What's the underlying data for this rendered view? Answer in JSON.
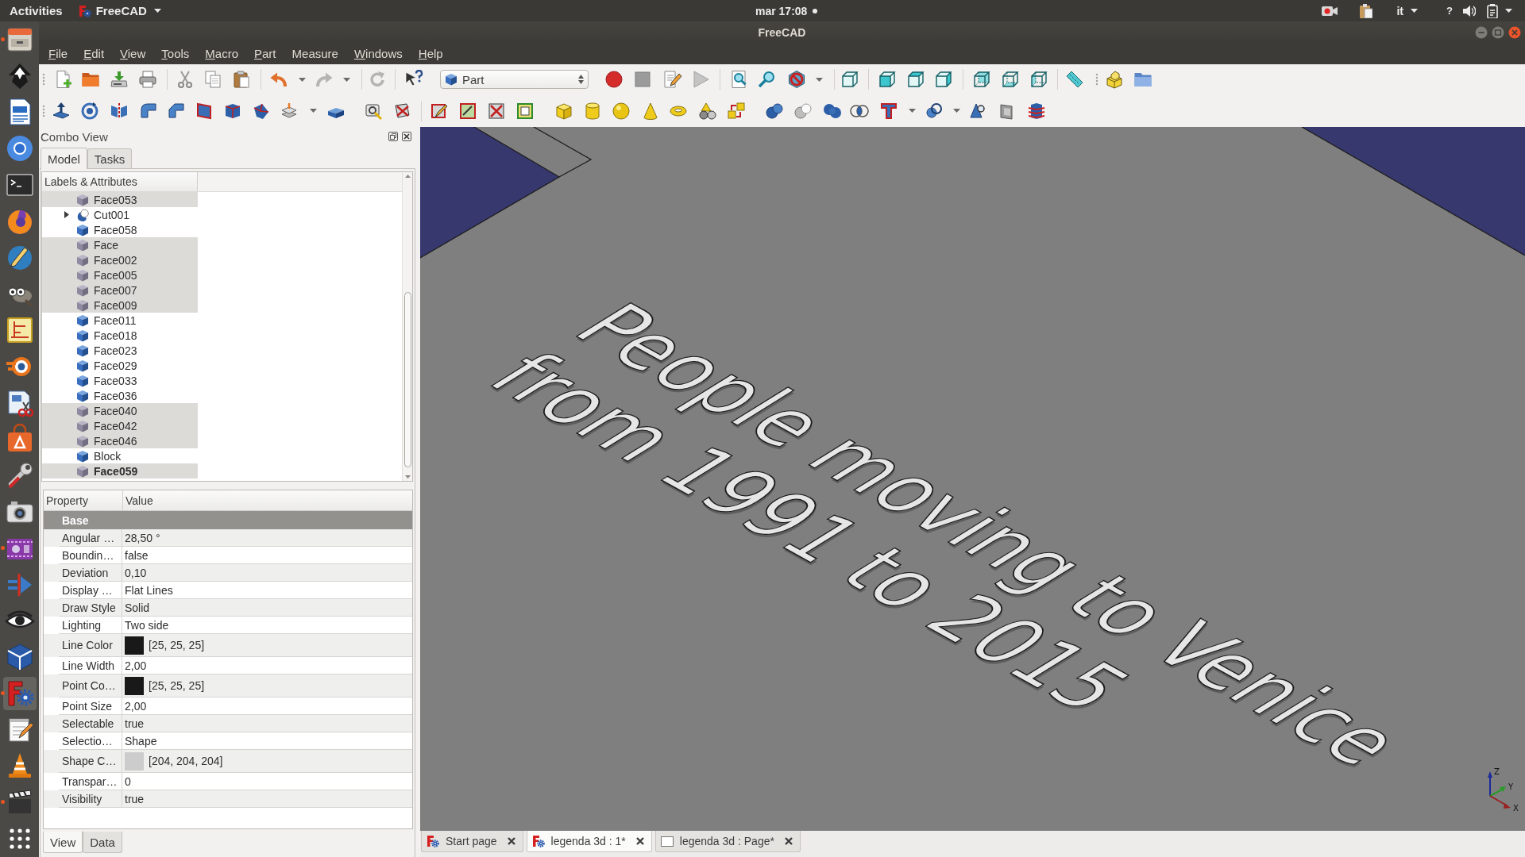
{
  "top_bar": {
    "activities": "Activities",
    "app_menu": "FreeCAD",
    "clock": "mar 17:08",
    "notification": true,
    "keyboard_layout": "it",
    "indicator": "?"
  },
  "launcher": [
    {
      "running": true,
      "selected": false
    },
    {
      "running": false,
      "selected": false
    },
    {
      "running": false,
      "selected": false
    },
    {
      "running": false,
      "selected": false
    },
    {
      "running": false,
      "selected": false
    },
    {
      "running": false,
      "selected": false
    },
    {
      "running": false,
      "selected": false
    },
    {
      "running": false,
      "selected": false
    },
    {
      "running": false,
      "selected": false
    },
    {
      "running": false,
      "selected": false
    },
    {
      "running": false,
      "selected": false
    },
    {
      "running": false,
      "selected": false
    },
    {
      "running": false,
      "selected": false
    },
    {
      "running": false,
      "selected": false
    },
    {
      "running": true,
      "selected": false
    },
    {
      "running": false,
      "selected": false
    },
    {
      "running": false,
      "selected": false
    },
    {
      "running": false,
      "selected": false
    },
    {
      "running": true,
      "selected": true
    },
    {
      "running": false,
      "selected": false
    },
    {
      "running": false,
      "selected": false
    },
    {
      "running": true,
      "selected": false
    },
    {
      "running": false,
      "selected": false
    }
  ],
  "window": {
    "title": "FreeCAD"
  },
  "menu_bar": [
    {
      "label": "File",
      "mnemonic": true
    },
    {
      "label": "Edit",
      "mnemonic": true
    },
    {
      "label": "View",
      "mnemonic": true
    },
    {
      "label": "Tools",
      "mnemonic": true
    },
    {
      "label": "Macro",
      "mnemonic": true
    },
    {
      "label": "Part",
      "mnemonic": true
    },
    {
      "label": "Measure",
      "mnemonic": false
    },
    {
      "label": "Windows",
      "mnemonic": true
    },
    {
      "label": "Help",
      "mnemonic": true
    }
  ],
  "toolbar": {
    "workbench": "Part"
  },
  "combo_view": {
    "title": "Combo View",
    "tabs": [
      {
        "label": "Model",
        "selected": true
      },
      {
        "label": "Tasks",
        "selected": false
      }
    ],
    "tree": {
      "column": "Labels & Attributes",
      "items": [
        {
          "label": "Face053",
          "kind": "shape",
          "visible": false,
          "selected": true,
          "bold": false,
          "expandable": false
        },
        {
          "label": "Cut001",
          "kind": "cut",
          "visible": true,
          "selected": false,
          "bold": false,
          "expandable": true
        },
        {
          "label": "Face058",
          "kind": "shape",
          "visible": true,
          "selected": false,
          "bold": false,
          "expandable": false
        },
        {
          "label": "Face",
          "kind": "shape",
          "visible": false,
          "selected": true,
          "bold": false,
          "expandable": false
        },
        {
          "label": "Face002",
          "kind": "shape",
          "visible": false,
          "selected": true,
          "bold": false,
          "expandable": false
        },
        {
          "label": "Face005",
          "kind": "shape",
          "visible": false,
          "selected": true,
          "bold": false,
          "expandable": false
        },
        {
          "label": "Face007",
          "kind": "shape",
          "visible": false,
          "selected": true,
          "bold": false,
          "expandable": false
        },
        {
          "label": "Face009",
          "kind": "shape",
          "visible": false,
          "selected": true,
          "bold": false,
          "expandable": false
        },
        {
          "label": "Face011",
          "kind": "shape",
          "visible": true,
          "selected": false,
          "bold": false,
          "expandable": false
        },
        {
          "label": "Face018",
          "kind": "shape",
          "visible": true,
          "selected": false,
          "bold": false,
          "expandable": false
        },
        {
          "label": "Face023",
          "kind": "shape",
          "visible": true,
          "selected": false,
          "bold": false,
          "expandable": false
        },
        {
          "label": "Face029",
          "kind": "shape",
          "visible": true,
          "selected": false,
          "bold": false,
          "expandable": false
        },
        {
          "label": "Face033",
          "kind": "shape",
          "visible": true,
          "selected": false,
          "bold": false,
          "expandable": false
        },
        {
          "label": "Face036",
          "kind": "shape",
          "visible": true,
          "selected": false,
          "bold": false,
          "expandable": false
        },
        {
          "label": "Face040",
          "kind": "shape",
          "visible": false,
          "selected": true,
          "bold": false,
          "expandable": false
        },
        {
          "label": "Face042",
          "kind": "shape",
          "visible": false,
          "selected": true,
          "bold": false,
          "expandable": false
        },
        {
          "label": "Face046",
          "kind": "shape",
          "visible": false,
          "selected": true,
          "bold": false,
          "expandable": false
        },
        {
          "label": "Block",
          "kind": "shape",
          "visible": true,
          "selected": false,
          "bold": false,
          "expandable": false
        },
        {
          "label": "Face059",
          "kind": "shape",
          "visible": false,
          "selected": true,
          "bold": true,
          "expandable": false
        }
      ]
    },
    "properties": {
      "columns": [
        "Property",
        "Value"
      ],
      "groups": [
        {
          "name": "Base",
          "rows": [
            {
              "name": "Angular …",
              "value": "28,50 °",
              "kind": "text"
            },
            {
              "name": "Boundin…",
              "value": "false",
              "kind": "text"
            },
            {
              "name": "Deviation",
              "value": "0,10",
              "kind": "text"
            },
            {
              "name": "Display …",
              "value": "Flat Lines",
              "kind": "text"
            },
            {
              "name": "Draw Style",
              "value": "Solid",
              "kind": "text"
            },
            {
              "name": "Lighting",
              "value": "Two side",
              "kind": "text"
            },
            {
              "name": "Line Color",
              "value": "[25, 25, 25]",
              "kind": "color",
              "color": "#191919"
            },
            {
              "name": "Line Width",
              "value": "2,00",
              "kind": "text"
            },
            {
              "name": "Point Co…",
              "value": "[25, 25, 25]",
              "kind": "color",
              "color": "#191919"
            },
            {
              "name": "Point Size",
              "value": "2,00",
              "kind": "text"
            },
            {
              "name": "Selectable",
              "value": "true",
              "kind": "text"
            },
            {
              "name": "Selectio…",
              "value": "Shape",
              "kind": "text"
            },
            {
              "name": "Shape C…",
              "value": "[204, 204, 204]",
              "kind": "color",
              "color": "#cccccc"
            },
            {
              "name": "Transpar…",
              "value": "0",
              "kind": "text"
            },
            {
              "name": "Visibility",
              "value": "true",
              "kind": "text"
            }
          ]
        }
      ]
    },
    "bottom_tabs": [
      {
        "label": "View",
        "selected": true
      },
      {
        "label": "Data",
        "selected": false
      }
    ]
  },
  "viewport": {
    "model_text": [
      "People moving to Venice",
      "from 1991 to 2015"
    ],
    "axes": [
      "Z",
      "Y",
      "X"
    ]
  },
  "document_tabs": [
    {
      "label": "Start page",
      "kind": "app",
      "selected": false
    },
    {
      "label": "legenda 3d : 1*",
      "kind": "app",
      "selected": true
    },
    {
      "label": "legenda 3d : Page*",
      "kind": "page",
      "selected": false
    }
  ]
}
